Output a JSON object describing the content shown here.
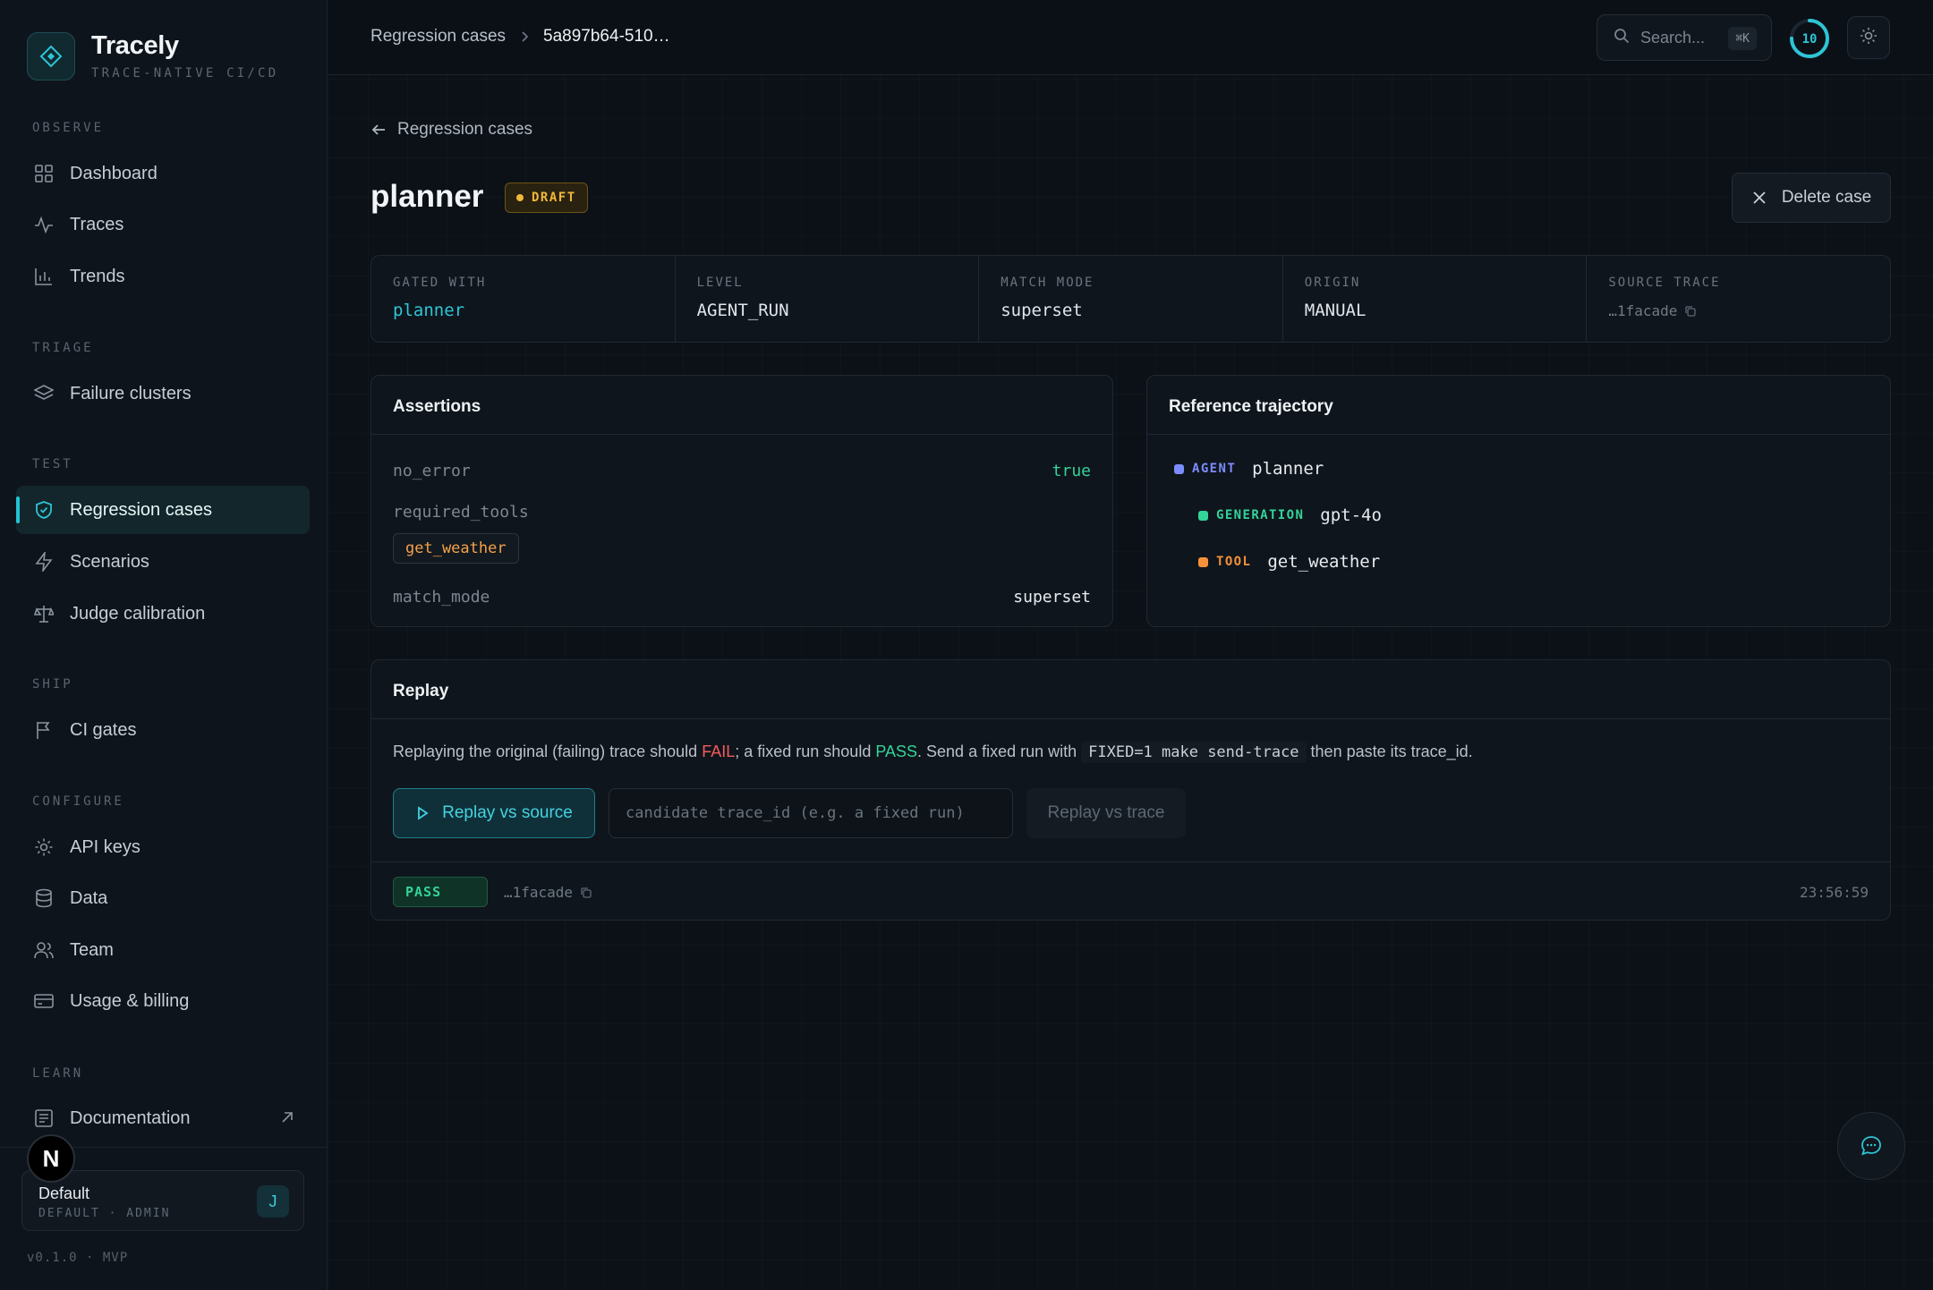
{
  "brand": {
    "name": "Tracely",
    "tagline": "TRACE-NATIVE CI/CD"
  },
  "sidebar": {
    "sections": {
      "observe": "OBSERVE",
      "triage": "TRIAGE",
      "test": "TEST",
      "ship": "SHIP",
      "configure": "CONFIGURE",
      "learn": "LEARN"
    },
    "items": {
      "dashboard": "Dashboard",
      "traces": "Traces",
      "trends": "Trends",
      "failure_clusters": "Failure clusters",
      "regression_cases": "Regression cases",
      "scenarios": "Scenarios",
      "judge_calibration": "Judge calibration",
      "ci_gates": "CI gates",
      "api_keys": "API keys",
      "data": "Data",
      "team": "Team",
      "usage_billing": "Usage & billing",
      "documentation": "Documentation"
    },
    "active_item": "regression_cases",
    "workspace": {
      "name": "Default",
      "role": "DEFAULT · ADMIN",
      "avatar": "J"
    },
    "n_badge": "N",
    "version": "v0.1.0 · MVP"
  },
  "topbar": {
    "breadcrumb_parent": "Regression cases",
    "breadcrumb_current": "5a897b64-510…",
    "search_placeholder": "Search...",
    "search_shortcut": "⌘K",
    "ring_count": "10",
    "ring_progress": 0.75
  },
  "page": {
    "back_label": "Regression cases",
    "title": "planner",
    "status_badge": "DRAFT",
    "delete_label": "Delete case"
  },
  "meta": {
    "gated_with": {
      "label": "GATED WITH",
      "value": "planner"
    },
    "level": {
      "label": "LEVEL",
      "value": "AGENT_RUN"
    },
    "match_mode": {
      "label": "MATCH MODE",
      "value": "superset"
    },
    "origin": {
      "label": "ORIGIN",
      "value": "MANUAL"
    },
    "source_trace": {
      "label": "SOURCE TRACE",
      "value": "…1facade"
    }
  },
  "assertions": {
    "title": "Assertions",
    "no_error": {
      "key": "no_error",
      "value": "true"
    },
    "required_tools": {
      "key": "required_tools",
      "tool": "get_weather"
    },
    "match_mode": {
      "key": "match_mode",
      "value": "superset"
    }
  },
  "trajectory": {
    "title": "Reference trajectory",
    "steps": [
      {
        "kind": "AGENT",
        "name": "planner",
        "color": "#7b8cff"
      },
      {
        "kind": "GENERATION",
        "name": "gpt-4o",
        "color": "#34d399"
      },
      {
        "kind": "TOOL",
        "name": "get_weather",
        "color": "#f5913a"
      }
    ]
  },
  "replay": {
    "title": "Replay",
    "desc_1": "Replaying the original (failing) trace should ",
    "desc_fail": "FAIL",
    "desc_2": "; a fixed run should ",
    "desc_pass": "PASS",
    "desc_3": ". Send a fixed run with ",
    "desc_code": "FIXED=1 make send-trace",
    "desc_4": " then paste its trace_id.",
    "replay_source_label": "Replay vs source",
    "candidate_placeholder": "candidate trace_id (e.g. a fixed run)",
    "replay_trace_label": "Replay vs trace",
    "result_status": "PASS",
    "result_trace": "…1facade",
    "result_time": "23:56:59"
  }
}
